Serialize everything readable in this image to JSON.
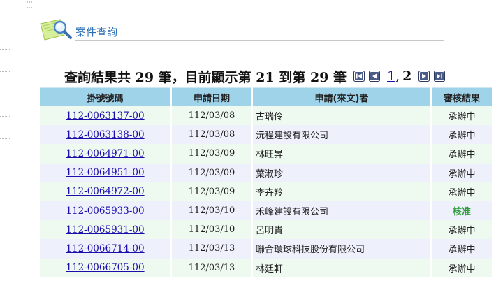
{
  "header": {
    "title": "案件查詢"
  },
  "summary": {
    "text": "查詢結果共 29 筆，目前顯示第 21 到第 29 筆",
    "page_link": "1",
    "page_sep": ",",
    "page_current": "2"
  },
  "table": {
    "columns": [
      "掛號號碼",
      "申請日期",
      "申請(來文)者",
      "審核結果"
    ],
    "rows": [
      {
        "no": "112-0063137-00",
        "date": "112/03/08",
        "applicant": "古瑞伶",
        "result": "承辦中"
      },
      {
        "no": "112-0063138-00",
        "date": "112/03/08",
        "applicant": "沅程建設有限公司",
        "result": "承辦中"
      },
      {
        "no": "112-0064971-00",
        "date": "112/03/09",
        "applicant": "林旺昇",
        "result": "承辦中"
      },
      {
        "no": "112-0064951-00",
        "date": "112/03/09",
        "applicant": "葉淑珍",
        "result": "承辦中"
      },
      {
        "no": "112-0064972-00",
        "date": "112/03/09",
        "applicant": "李卉羚",
        "result": "承辦中"
      },
      {
        "no": "112-0065933-00",
        "date": "112/03/10",
        "applicant": "禾峰建設有限公司",
        "result": "核准"
      },
      {
        "no": "112-0065931-00",
        "date": "112/03/10",
        "applicant": "呂明貴",
        "result": "承辦中"
      },
      {
        "no": "112-0066714-00",
        "date": "112/03/13",
        "applicant": "聯合環球科技股份有限公司",
        "result": "承辦中"
      },
      {
        "no": "112-0066705-00",
        "date": "112/03/13",
        "applicant": "林廷軒",
        "result": "承辦中"
      }
    ]
  },
  "icons": {
    "header": "magnifier-document-icon",
    "nav": [
      "first-page-icon",
      "previous-page-icon",
      "next-page-icon",
      "last-page-icon"
    ]
  },
  "colors": {
    "header_bg": "#9fd3ea",
    "row_odd": "#eef9f0",
    "row_even": "#eef0fb",
    "link": "#1a0dab",
    "approved": "#2f9a3a",
    "pending": "#7d7d7d"
  }
}
